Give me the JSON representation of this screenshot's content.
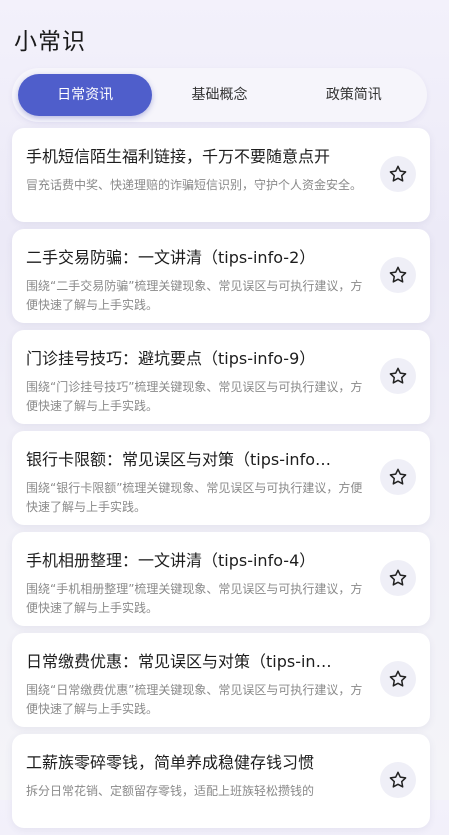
{
  "header": {
    "title": "小常识"
  },
  "tabs": [
    {
      "label": "日常资讯",
      "active": true
    },
    {
      "label": "基础概念",
      "active": false
    },
    {
      "label": "政策简讯",
      "active": false
    }
  ],
  "cards": [
    {
      "title": "手机短信陌生福利链接，千万不要随意点开",
      "desc": "冒充话费中奖、快递理赔的诈骗短信识别，守护个人资金安全。",
      "icon": "star-outline-icon"
    },
    {
      "title": "二手交易防骗：一文讲清（tips-info-2）",
      "desc": "围绕“二手交易防骗”梳理关键现象、常见误区与可执行建议，方便快速了解与上手实践。",
      "icon": "star-outline-icon"
    },
    {
      "title": "门诊挂号技巧：避坑要点（tips-info-9）",
      "desc": "围绕“门诊挂号技巧”梳理关键现象、常见误区与可执行建议，方便快速了解与上手实践。",
      "icon": "star-outline-icon"
    },
    {
      "title": "银行卡限额：常见误区与对策（tips-info…",
      "desc": "围绕“银行卡限额”梳理关键现象、常见误区与可执行建议，方便快速了解与上手实践。",
      "icon": "star-outline-icon"
    },
    {
      "title": "手机相册整理：一文讲清（tips-info-4）",
      "desc": "围绕“手机相册整理”梳理关键现象、常见误区与可执行建议，方便快速了解与上手实践。",
      "icon": "star-outline-icon"
    },
    {
      "title": "日常缴费优惠：常见误区与对策（tips-in…",
      "desc": "围绕“日常缴费优惠”梳理关键现象、常见误区与可执行建议，方便快速了解与上手实践。",
      "icon": "star-outline-icon"
    },
    {
      "title": "工薪族零碎零钱，简单养成稳健存钱习惯",
      "desc": "拆分日常花销、定额留存零钱，适配上班族轻松攒钱的",
      "icon": "star-outline-icon"
    }
  ],
  "colors": {
    "accent": "#4f5ecb",
    "star_stroke": "#222222",
    "star_button_bg": "#efeff7"
  }
}
